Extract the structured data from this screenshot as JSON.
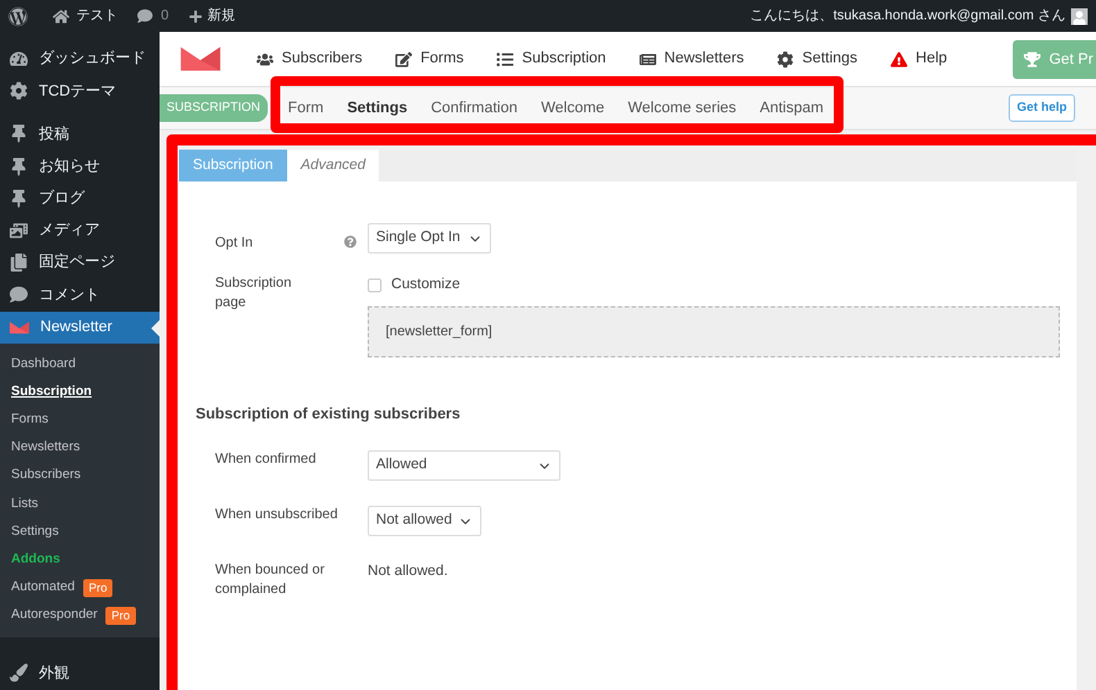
{
  "admin_bar": {
    "site": "テスト",
    "comments": "0",
    "new": "新規",
    "greeting": "こんにちは、tsukasa.honda.work@gmail.com さん"
  },
  "sidebar": {
    "items": [
      {
        "label": "ダッシュボード"
      },
      {
        "label": "TCDテーマ"
      },
      {
        "label": "投稿"
      },
      {
        "label": "お知らせ"
      },
      {
        "label": "ブログ"
      },
      {
        "label": "メディア"
      },
      {
        "label": "固定ページ"
      },
      {
        "label": "コメント"
      },
      {
        "label": "Newsletter",
        "selected": true
      }
    ],
    "submenu": [
      {
        "label": "Dashboard",
        "selected": false
      },
      {
        "label": "Subscription",
        "selected": true
      },
      {
        "label": "Forms",
        "selected": false
      },
      {
        "label": "Newsletters",
        "selected": false
      },
      {
        "label": "Subscribers",
        "selected": false
      },
      {
        "label": "Lists",
        "selected": false
      },
      {
        "label": "Settings",
        "selected": false
      },
      {
        "label": "Addons",
        "selected": false,
        "color": "#1db954"
      },
      {
        "label": "Automated",
        "selected": false,
        "badge": "Pro"
      },
      {
        "label": "Autoresponder",
        "selected": false,
        "badge": "Pro"
      }
    ],
    "after": [
      {
        "label": "外観"
      }
    ]
  },
  "top_nav": [
    {
      "label": "Subscribers"
    },
    {
      "label": "Forms"
    },
    {
      "label": "Subscription"
    },
    {
      "label": "Newsletters"
    },
    {
      "label": "Settings"
    },
    {
      "label": "Help"
    }
  ],
  "get_pro": "Get Pr",
  "section_badge": "SUBSCRIPTION",
  "sub_tabs": [
    {
      "label": "Form",
      "selected": false
    },
    {
      "label": "Settings",
      "selected": true
    },
    {
      "label": "Confirmation",
      "selected": false
    },
    {
      "label": "Welcome",
      "selected": false
    },
    {
      "label": "Welcome series",
      "selected": false
    },
    {
      "label": "Antispam",
      "selected": false
    }
  ],
  "get_help": "Get help",
  "panel_tabs": [
    {
      "label": "Subscription",
      "selected": true
    },
    {
      "label": "Advanced",
      "selected": false
    }
  ],
  "opt_in": {
    "label": "Opt In",
    "value": "Single Opt In"
  },
  "subscription_page": {
    "label": "Subscription page",
    "customize": "Customize",
    "checked": false,
    "shortcode": "[newsletter_form]"
  },
  "existing": {
    "heading": "Subscription of existing subscribers",
    "rows": [
      {
        "kind": "select",
        "label": "When confirmed",
        "value": "Allowed"
      },
      {
        "kind": "select",
        "label": "When unsubscribed",
        "value": "Not allowed"
      },
      {
        "kind": "text",
        "label": "When bounced or complained",
        "value": "Not allowed."
      }
    ]
  }
}
